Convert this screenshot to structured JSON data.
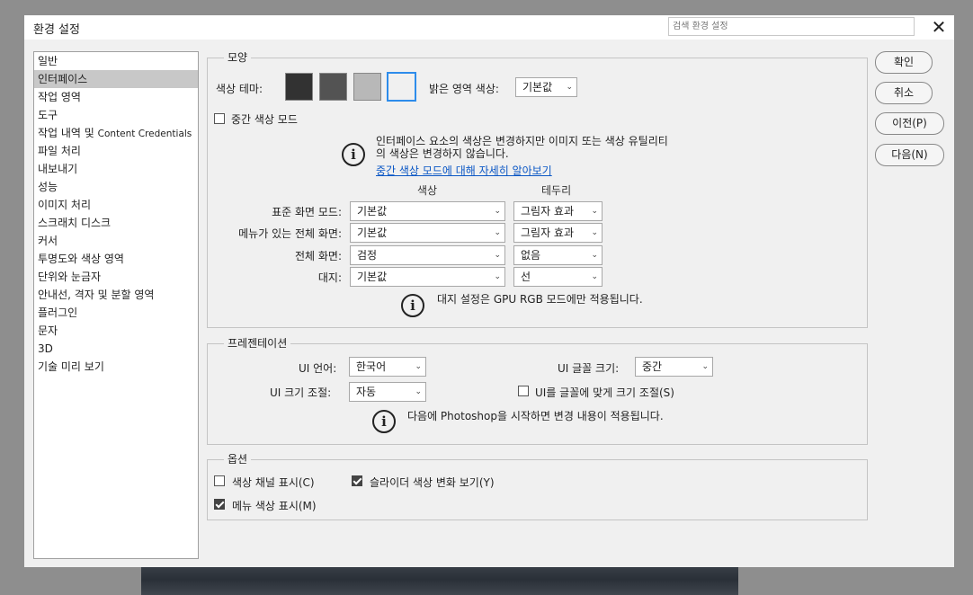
{
  "dialog": {
    "title": "환경 설정",
    "search_placeholder": "검색 환경 설정"
  },
  "sidebar": {
    "items": [
      {
        "label": "일반"
      },
      {
        "label": "인터페이스",
        "selected": true
      },
      {
        "label": "작업 영역"
      },
      {
        "label": "도구"
      },
      {
        "label": "작업 내역 및 ",
        "suffix": "Content Credentials"
      },
      {
        "label": "파일 처리"
      },
      {
        "label": "내보내기"
      },
      {
        "label": "성능"
      },
      {
        "label": "이미지 처리"
      },
      {
        "label": "스크래치 디스크"
      },
      {
        "label": "커서"
      },
      {
        "label": "투명도와 색상 영역"
      },
      {
        "label": "단위와 눈금자"
      },
      {
        "label": "안내선, 격자 및 분할 영역"
      },
      {
        "label": "플러그인"
      },
      {
        "label": "문자"
      },
      {
        "label": "3D"
      },
      {
        "label": "기술 미리 보기"
      }
    ]
  },
  "appearance": {
    "title": "모양",
    "color_theme_label": "색상 테마:",
    "themes": [
      {
        "color": "#323232",
        "selected": false
      },
      {
        "color": "#535353",
        "selected": false
      },
      {
        "color": "#b8b8b8",
        "selected": false
      },
      {
        "color": "#f0f0f0",
        "selected": true
      }
    ],
    "highlight_label": "밝은 영역 색상:",
    "highlight_value": "기본값",
    "mid_gray_label": "중간 색상 모드",
    "mid_gray_checked": false,
    "info_line1": "인터페이스 요소의 색상은 변경하지만 이미지 또는 색상 유틸리티",
    "info_line2": "의 색상은 변경하지 않습니다.",
    "info_link": "중간 색상 모드에 대해 자세히 알아보기",
    "col_color": "색상",
    "col_border": "테두리",
    "rows": [
      {
        "label": "표준 화면 모드:",
        "color": "기본값",
        "border": "그림자 효과"
      },
      {
        "label": "메뉴가 있는 전체 화면:",
        "color": "기본값",
        "border": "그림자 효과"
      },
      {
        "label": "전체 화면:",
        "color": "검정",
        "border": "없음"
      },
      {
        "label": "대지:",
        "color": "기본값",
        "border": "선"
      }
    ],
    "artboard_note": "대지 설정은 GPU RGB 모드에만 적용됩니다."
  },
  "presentation": {
    "title": "프레젠테이션",
    "language_label": "UI 언어:",
    "language_value": "한국어",
    "font_size_label": "UI 글꼴 크기:",
    "font_size_value": "중간",
    "scale_label": "UI 크기 조절:",
    "scale_value": "자동",
    "scale_to_font_label": "UI를 글꼴에 맞게 크기 조절(S)",
    "scale_to_font_checked": false,
    "note": "다음에 Photoshop을 시작하면 변경 내용이 적용됩니다."
  },
  "options": {
    "title": "옵션",
    "show_channels_label": "색상 채널 표시(C)",
    "show_channels_checked": false,
    "slider_label": "슬라이더 색상 변화 보기(Y)",
    "slider_checked": true,
    "menu_colors_label": "메뉴 색상 표시(M)",
    "menu_colors_checked": true
  },
  "buttons": {
    "ok": "확인",
    "cancel": "취소",
    "prev": "이전(P)",
    "next": "다음(N)"
  }
}
